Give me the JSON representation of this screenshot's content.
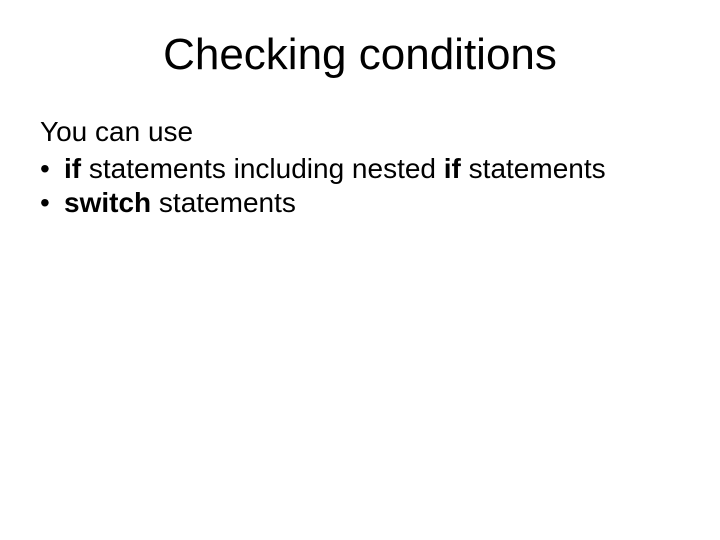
{
  "title": "Checking conditions",
  "intro": "You can use",
  "bullets": [
    {
      "runs": [
        {
          "text": "if",
          "bold": true
        },
        {
          "text": " statements including nested ",
          "bold": false
        },
        {
          "text": "if",
          "bold": true
        },
        {
          "text": " statements",
          "bold": false
        }
      ]
    },
    {
      "runs": [
        {
          "text": "switch",
          "bold": true
        },
        {
          "text": " statements",
          "bold": false
        }
      ]
    }
  ]
}
